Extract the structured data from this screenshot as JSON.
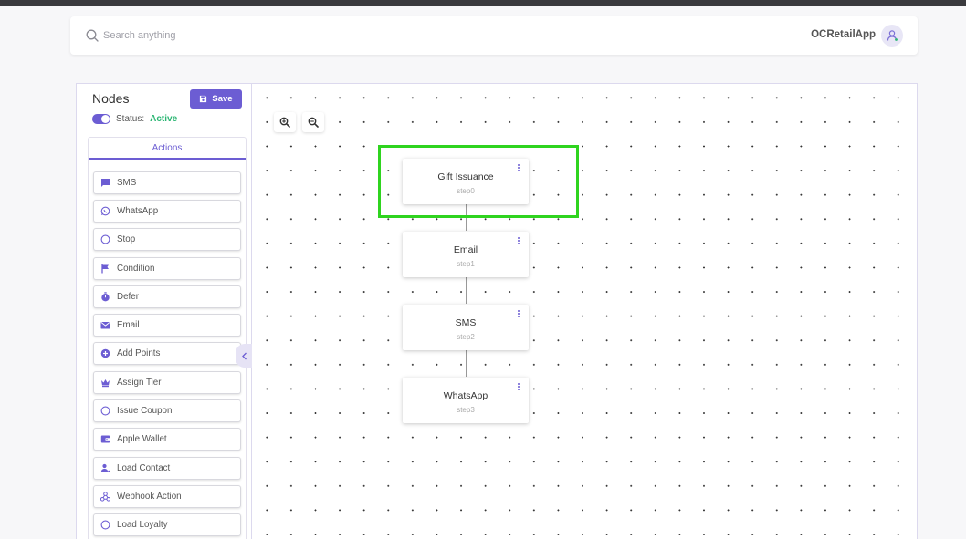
{
  "header": {
    "search_placeholder": "Search anything",
    "app_name": "OCRetailApp"
  },
  "panel": {
    "title": "Nodes",
    "save_label": "Save",
    "status_label": "Status:",
    "status_value": "Active",
    "tab_label": "Actions",
    "actions": [
      {
        "label": "SMS",
        "icon": "message-icon"
      },
      {
        "label": "WhatsApp",
        "icon": "whatsapp-icon"
      },
      {
        "label": "Stop",
        "icon": "circle-icon"
      },
      {
        "label": "Condition",
        "icon": "flag-icon"
      },
      {
        "label": "Defer",
        "icon": "timer-icon"
      },
      {
        "label": "Email",
        "icon": "mail-icon"
      },
      {
        "label": "Add Points",
        "icon": "plus-circle-icon"
      },
      {
        "label": "Assign Tier",
        "icon": "crown-icon"
      },
      {
        "label": "Issue Coupon",
        "icon": "circle-icon"
      },
      {
        "label": "Apple Wallet",
        "icon": "wallet-icon"
      },
      {
        "label": "Load Contact",
        "icon": "person-icon"
      },
      {
        "label": "Webhook Action",
        "icon": "webhook-icon"
      },
      {
        "label": "Load Loyalty",
        "icon": "circle-icon"
      }
    ]
  },
  "flow": {
    "selected_node": "step0",
    "nodes": [
      {
        "title": "Gift Issuance",
        "step": "step0"
      },
      {
        "title": "Email",
        "step": "step1"
      },
      {
        "title": "SMS",
        "step": "step2"
      },
      {
        "title": "WhatsApp",
        "step": "step3"
      }
    ]
  },
  "colors": {
    "accent": "#6c5dd3",
    "active_status": "#2bb673",
    "selection": "#2fd41f"
  }
}
